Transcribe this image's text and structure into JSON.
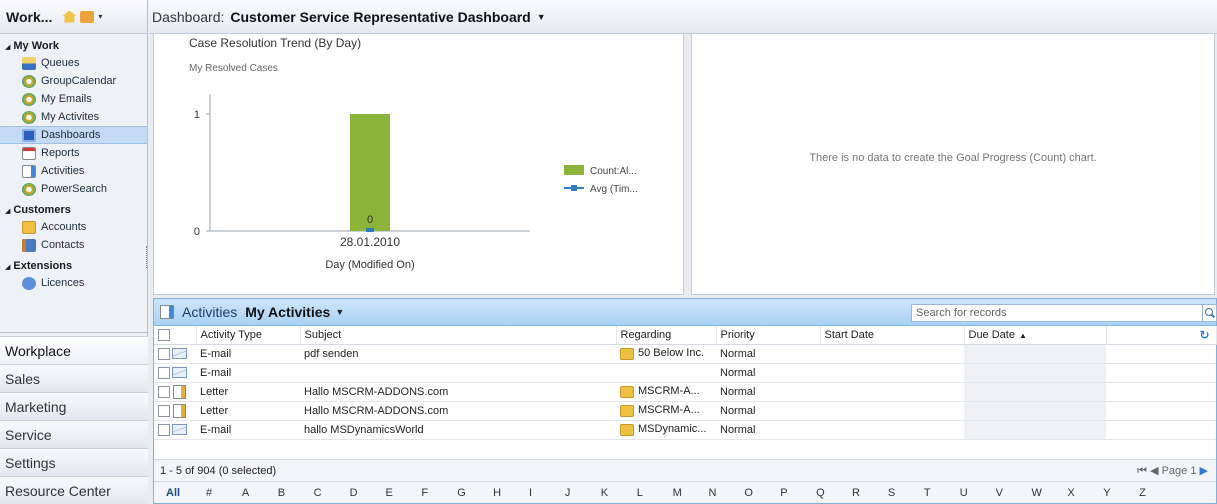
{
  "nav": {
    "title": "Work...",
    "groups": [
      {
        "label": "My Work",
        "items": [
          "Queues",
          "GroupCalendar",
          "My Emails",
          "My Activites",
          "Dashboards",
          "Reports",
          "Activities",
          "PowerSearch"
        ]
      },
      {
        "label": "Customers",
        "items": [
          "Accounts",
          "Contacts"
        ]
      },
      {
        "label": "Extensions",
        "items": [
          "Licences"
        ]
      }
    ],
    "areas": [
      "Workplace",
      "Sales",
      "Marketing",
      "Service",
      "Settings",
      "Resource Center"
    ]
  },
  "dashboard": {
    "prefix": "Dashboard:",
    "name": "Customer Service Representative Dashboard",
    "goal_message": "There is no data to create the Goal Progress (Count) chart."
  },
  "chart_data": {
    "type": "bar",
    "title": "Case Resolution Trend (By Day)",
    "subtitle": "My Resolved Cases",
    "categories": [
      "28.01.2010"
    ],
    "series": [
      {
        "name": "Count:Al...",
        "type": "bar",
        "values": [
          1
        ],
        "color": "#8db43a"
      },
      {
        "name": "Avg (Tim...",
        "type": "line",
        "values": [
          0
        ],
        "color": "#2e7bc0"
      }
    ],
    "data_labels": [
      "0"
    ],
    "xlabel": "Day (Modified On)",
    "ylabel": "",
    "yticks": [
      "0",
      "1"
    ],
    "ylim": [
      0,
      1
    ]
  },
  "grid": {
    "entity": "Activities",
    "view": "My Activities",
    "search_placeholder": "Search for records",
    "columns": [
      "Activity Type",
      "Subject",
      "Regarding",
      "Priority",
      "Start Date",
      "Due Date"
    ],
    "rows": [
      {
        "type": "E-mail",
        "icon": "email-icon",
        "subject": "pdf senden",
        "regarding": "50 Below Inc.",
        "priority": "Normal",
        "start": "",
        "due": ""
      },
      {
        "type": "E-mail",
        "icon": "email-icon",
        "subject": "",
        "regarding": "",
        "priority": "Normal",
        "start": "",
        "due": ""
      },
      {
        "type": "Letter",
        "icon": "letter-icon",
        "subject": "Hallo MSCRM-ADDONS.com",
        "regarding": "MSCRM-A...",
        "priority": "Normal",
        "start": "",
        "due": ""
      },
      {
        "type": "Letter",
        "icon": "letter-icon",
        "subject": "Hallo MSCRM-ADDONS.com",
        "regarding": "MSCRM-A...",
        "priority": "Normal",
        "start": "",
        "due": ""
      },
      {
        "type": "E-mail",
        "icon": "email-icon",
        "subject": "hallo MSDynamicsWorld",
        "regarding": "MSDynamic...",
        "priority": "Normal",
        "start": "",
        "due": ""
      }
    ],
    "status": "1 - 5 of 904 (0 selected)",
    "page_label": "Page 1",
    "alphabet": [
      "All",
      "#",
      "A",
      "B",
      "C",
      "D",
      "E",
      "F",
      "G",
      "H",
      "I",
      "J",
      "K",
      "L",
      "M",
      "N",
      "O",
      "P",
      "Q",
      "R",
      "S",
      "T",
      "U",
      "V",
      "W",
      "X",
      "Y",
      "Z"
    ]
  }
}
